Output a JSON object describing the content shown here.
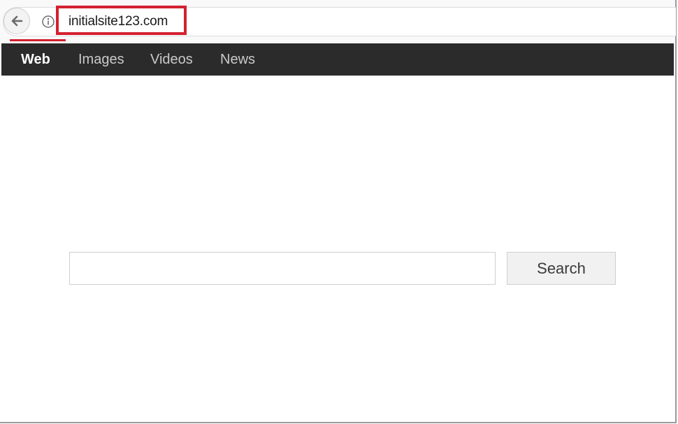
{
  "browser": {
    "url": "initialsite123.com",
    "back_icon": "arrow-left-icon",
    "info_icon": "info-circle-icon",
    "highlight_color": "#d42030"
  },
  "nav": {
    "items": [
      {
        "label": "Web",
        "active": true
      },
      {
        "label": "Images",
        "active": false
      },
      {
        "label": "Videos",
        "active": false
      },
      {
        "label": "News",
        "active": false
      }
    ],
    "background": "#2b2b2b"
  },
  "search": {
    "value": "",
    "button_label": "Search"
  }
}
